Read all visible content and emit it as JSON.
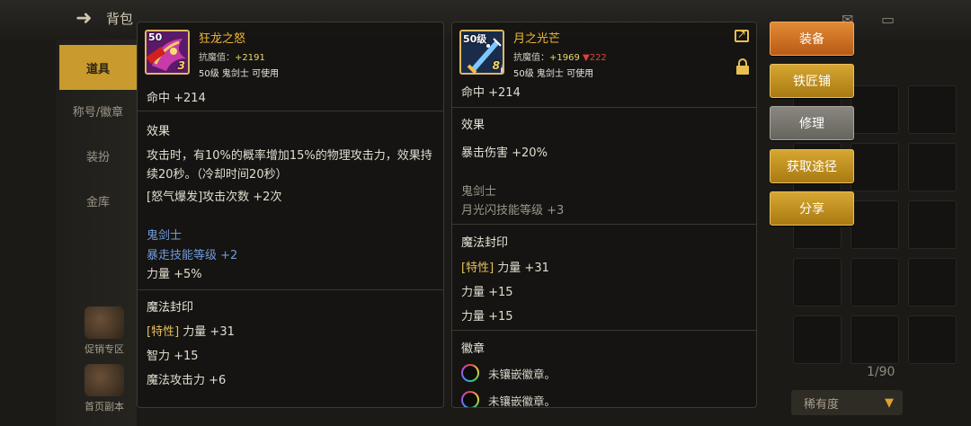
{
  "background": {
    "back_icon": "left-arrow-icon",
    "title": "背包",
    "sidebar": [
      "道具",
      "称号/徽章",
      "装扮",
      "金库"
    ],
    "bottom_icons": [
      "促销专区",
      "首页副本"
    ],
    "inventory_count": "1/90",
    "sort_label": "稀有度"
  },
  "left_item": {
    "icon": "dragon-fury-icon",
    "level_badge": "50",
    "grade_badge": "3",
    "name": "狂龙之怒",
    "resist_label": "抗魔值：",
    "resist_value": "+2191",
    "requirement": "50级 鬼剑士 可使用",
    "hit": "命中 +214",
    "effect_header": "效果",
    "effect_text": "攻击时，有10%的概率增加15%的物理攻击力，效果持续20秒。（冷却时间20秒）",
    "effect_extra": "[怒气爆发]攻击次数 +2次",
    "class_name": "鬼剑士",
    "class_skill": "暴走技能等级 +2",
    "strength": "力量 +5%",
    "seal_header": "魔法封印",
    "seal_trait_tag": "[特性]",
    "seal_trait_stat": "力量 +31",
    "seal_intel": "智力 +15",
    "seal_magic_atk": "魔法攻击力 +6"
  },
  "right_item": {
    "icon": "moonlight-sword-icon",
    "level_badge": "50级",
    "grade_badge": "8",
    "name": "月之光芒",
    "resist_label": "抗魔值：",
    "resist_value": "+1969",
    "resist_diff": "▼222",
    "requirement": "50级 鬼剑士 可使用",
    "hit": "命中 +214",
    "effect_header": "效果",
    "crit_damage": "暴击伤害 +20%",
    "class_name": "鬼剑士",
    "class_skill": "月光闪技能等级 +3",
    "seal_header": "魔法封印",
    "seal_trait_tag": "[特性]",
    "seal_trait_stat": "力量 +31",
    "seal_str_1": "力量 +15",
    "seal_str_2": "力量 +15",
    "emblem_header": "徽章",
    "emblem_empty_1": "未镶嵌徽章。",
    "emblem_empty_2": "未镶嵌徽章。"
  },
  "actions": {
    "equip": "装备",
    "blacksmith": "铁匠铺",
    "repair": "修理",
    "obtain": "获取途径",
    "share": "分享"
  },
  "colors": {
    "item_name": "#f0b83a",
    "skill_blue": "#6f9bd8",
    "button_orange": "#c96c20",
    "button_gold": "#c0901f",
    "button_grey": "#77746c"
  }
}
